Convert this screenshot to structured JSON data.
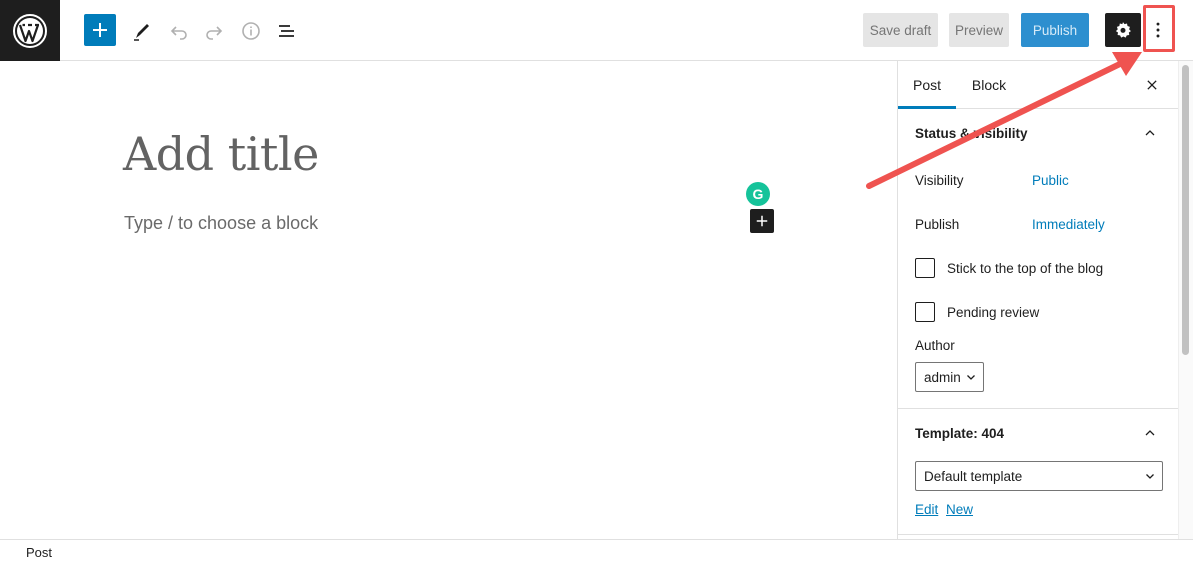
{
  "toolbar": {
    "save_draft_label": "Save draft",
    "preview_label": "Preview",
    "publish_label": "Publish",
    "icons": [
      "wordpress-logo-icon",
      "plus-icon",
      "pencil-icon",
      "undo-icon",
      "redo-icon",
      "info-icon",
      "list-view-icon",
      "gear-icon",
      "more-vertical-icon"
    ],
    "colors": {
      "accent": "#007cba",
      "publish_bg": "#2d8fcf",
      "dark": "#1e1e1e",
      "annotation": "#ef5350"
    }
  },
  "editor": {
    "title_placeholder": "Add title",
    "block_placeholder": "Type / to choose a block",
    "grammarly_letter": "G"
  },
  "sidebar": {
    "tabs": [
      {
        "label": "Post",
        "active": true
      },
      {
        "label": "Block",
        "active": false
      }
    ],
    "status_panel": {
      "title": "Status & visibility",
      "visibility_label": "Visibility",
      "visibility_value": "Public",
      "publish_label": "Publish",
      "publish_value": "Immediately",
      "sticky_label": "Stick to the top of the blog",
      "sticky_checked": false,
      "pending_label": "Pending review",
      "pending_checked": false,
      "author_label": "Author",
      "author_value": "admin"
    },
    "template_panel": {
      "title": "Template: 404",
      "selected_template": "Default template",
      "edit_link": "Edit",
      "new_link": "New"
    }
  },
  "footer": {
    "breadcrumb": "Post"
  }
}
